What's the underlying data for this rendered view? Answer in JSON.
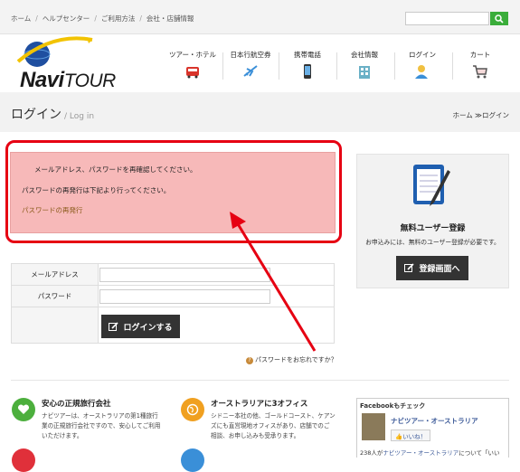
{
  "topbar": {
    "breadcrumbs": [
      "ホーム",
      "ヘルプセンター",
      "ご利用方法",
      "会社・店舗情報"
    ],
    "search_placeholder": ""
  },
  "logo": {
    "word1": "Navi",
    "word2": "TOUR"
  },
  "nav": {
    "items": [
      {
        "label": "ツアー・ホテル",
        "icon": "bus-icon"
      },
      {
        "label": "日本行航空券",
        "icon": "airplane-icon"
      },
      {
        "label": "携帯電話",
        "icon": "mobile-phone-icon"
      },
      {
        "label": "会社情報",
        "icon": "building-icon"
      },
      {
        "label": "ログイン",
        "icon": "user-login-icon"
      },
      {
        "label": "カート",
        "icon": "cart-icon"
      }
    ]
  },
  "page": {
    "title": "ログイン",
    "subtitle": "/ Log in",
    "breadcrumb_home": "ホーム",
    "breadcrumb_sep": "≫",
    "breadcrumb_current": "ログイン"
  },
  "alert": {
    "line1": "メールアドレス、パスワードを再確認してください。",
    "line2": "パスワードの再発行は下記より行ってください。",
    "link": "パスワードの再発行"
  },
  "form": {
    "email_label": "メールアドレス",
    "email_value": "",
    "password_label": "パスワード",
    "password_value": "",
    "login_button": "ログインする",
    "forgot_link": "パスワードをお忘れですか？"
  },
  "sidebar": {
    "title": "無料ユーザー登録",
    "text": "お申込みには、無料のユーザー登録が必要です。",
    "register_button": "登録画面へ"
  },
  "features": [
    {
      "title": "安心の正規旅行会社",
      "icon": "heart-icon",
      "color": "#4caf3d",
      "lines": [
        "ナビツアーは、オーストラリアの第1種旅行",
        "業の正規旅行会社ですので、安心してご利用",
        "いただけます。"
      ]
    },
    {
      "title": "オーストラリアに3オフィス",
      "icon": "globe-icon",
      "color": "#f0a020",
      "lines": [
        "シドニー本社の他、ゴールドコースト、ケアン",
        "ズにも直営現地オフィスがあり、店舗でのご",
        "相談、お申し込みも受承ります。"
      ]
    }
  ],
  "facebook": {
    "header": "Facebookもチェック",
    "page_name": "ナビツアー・オーストラリア",
    "like_label": "👍いいね！",
    "count_prefix": "238人が",
    "count_link": "ナビツアー・オーストラリア",
    "count_suffix": "について「いい"
  },
  "colors": {
    "alert_bg": "#f7b9b9",
    "annotation_red": "#e60012",
    "search_button": "#3aad3a",
    "dark_button": "#333333"
  }
}
